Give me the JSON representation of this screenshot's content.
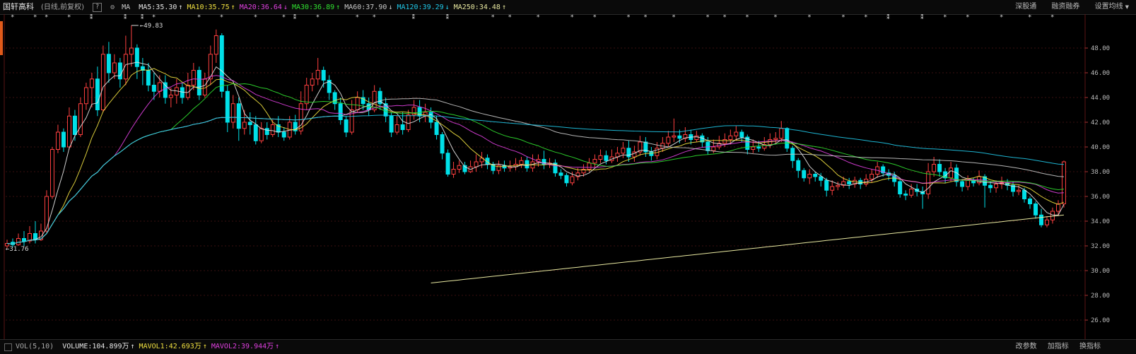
{
  "header": {
    "stock_name": "国轩高科",
    "period_label": "(日线,前复权)",
    "help_label": "?",
    "ma_label": "MA",
    "ma_items": [
      {
        "text": "MA5:35.30",
        "arrow": "↑",
        "color": "#e6e6e6"
      },
      {
        "text": "MA10:35.75",
        "arrow": "↑",
        "color": "#f0e040"
      },
      {
        "text": "MA20:36.64",
        "arrow": "↓",
        "color": "#e040e0"
      },
      {
        "text": "MA30:36.89",
        "arrow": "↑",
        "color": "#30e030"
      },
      {
        "text": "MA60:37.90",
        "arrow": "↓",
        "color": "#c8c8c8"
      },
      {
        "text": "MA120:39.29",
        "arrow": "↓",
        "color": "#20c8e8"
      },
      {
        "text": "MA250:34.48",
        "arrow": "↑",
        "color": "#e8e8a0"
      }
    ],
    "tools": [
      "深股通",
      "融资融券",
      "设置均线"
    ]
  },
  "footer": {
    "vol_name": "VOL(5,10)",
    "vol_items": [
      {
        "text": "VOLUME:104.899万",
        "arrow": "↑",
        "color": "#e6e6e6"
      },
      {
        "text": "MAVOL1:42.693万",
        "arrow": "↑",
        "color": "#f0e040"
      },
      {
        "text": "MAVOL2:39.944万",
        "arrow": "↑",
        "color": "#e040e0"
      }
    ],
    "tools": [
      "改参数",
      "加指标",
      "换指标"
    ]
  },
  "annotations": {
    "high": "49.83",
    "low": "31.76"
  },
  "colors": {
    "up": "#ff4040",
    "down": "#00e0e8",
    "grid": "#3a1010"
  },
  "chart_data": {
    "type": "candlestick",
    "ylim": [
      25,
      50
    ],
    "yticks": [
      "48.00",
      "46.00",
      "44.00",
      "42.00",
      "40.00",
      "38.00",
      "36.00",
      "34.00",
      "32.00",
      "30.00",
      "28.00",
      "26.00"
    ],
    "candles": [
      [
        32.0,
        32.2,
        31.8,
        32.5
      ],
      [
        32.3,
        32.1,
        31.9,
        32.6
      ],
      [
        32.1,
        32.6,
        32.0,
        33.0
      ],
      [
        32.6,
        32.4,
        32.0,
        33.2
      ],
      [
        32.4,
        33.0,
        32.2,
        33.6
      ],
      [
        33.0,
        32.5,
        32.2,
        34.0
      ],
      [
        32.5,
        33.2,
        32.4,
        33.8
      ],
      [
        33.2,
        36.0,
        33.0,
        36.5
      ],
      [
        36.0,
        39.8,
        35.8,
        40.0
      ],
      [
        39.8,
        41.2,
        39.5,
        41.8
      ],
      [
        41.2,
        40.0,
        39.6,
        41.5
      ],
      [
        40.0,
        42.5,
        39.8,
        43.2
      ],
      [
        42.5,
        41.0,
        40.5,
        43.0
      ],
      [
        41.0,
        43.5,
        40.8,
        44.0
      ],
      [
        43.5,
        44.8,
        43.0,
        45.2
      ],
      [
        44.8,
        45.5,
        43.2,
        46.0
      ],
      [
        45.5,
        43.0,
        42.5,
        46.5
      ],
      [
        43.0,
        47.5,
        42.8,
        48.2
      ],
      [
        47.5,
        46.0,
        45.2,
        48.5
      ],
      [
        46.0,
        46.8,
        45.5,
        47.5
      ],
      [
        46.8,
        45.5,
        44.8,
        47.2
      ],
      [
        45.5,
        47.5,
        45.0,
        49.0
      ],
      [
        47.5,
        48.0,
        46.5,
        49.83
      ],
      [
        48.0,
        46.5,
        45.5,
        48.3
      ],
      [
        46.5,
        46.2,
        45.0,
        47.2
      ],
      [
        46.2,
        45.0,
        44.5,
        46.8
      ],
      [
        45.0,
        44.5,
        43.8,
        46.0
      ],
      [
        44.5,
        45.2,
        44.0,
        45.8
      ],
      [
        45.2,
        44.0,
        43.5,
        45.8
      ],
      [
        44.0,
        44.2,
        43.2,
        44.8
      ],
      [
        44.2,
        44.8,
        43.5,
        45.5
      ],
      [
        44.8,
        44.0,
        43.5,
        45.2
      ],
      [
        44.0,
        45.0,
        43.8,
        46.0
      ],
      [
        45.0,
        46.2,
        44.6,
        46.8
      ],
      [
        46.2,
        44.2,
        43.8,
        46.5
      ],
      [
        44.2,
        45.5,
        44.0,
        46.0
      ],
      [
        45.5,
        47.5,
        45.0,
        48.2
      ],
      [
        47.5,
        49.0,
        46.8,
        49.5
      ],
      [
        49.0,
        44.5,
        44.0,
        49.2
      ],
      [
        44.5,
        42.0,
        41.2,
        45.0
      ],
      [
        42.0,
        43.5,
        41.5,
        44.2
      ],
      [
        43.5,
        41.5,
        40.5,
        44.0
      ],
      [
        41.5,
        42.0,
        41.0,
        43.0
      ],
      [
        42.0,
        41.8,
        41.0,
        42.8
      ],
      [
        41.8,
        40.5,
        40.2,
        42.5
      ],
      [
        40.5,
        41.5,
        40.3,
        42.0
      ],
      [
        41.5,
        41.0,
        40.6,
        42.0
      ],
      [
        41.0,
        41.8,
        40.8,
        42.2
      ],
      [
        41.8,
        41.2,
        40.8,
        42.5
      ],
      [
        41.2,
        40.8,
        40.5,
        41.6
      ],
      [
        40.8,
        42.0,
        40.6,
        42.5
      ],
      [
        42.0,
        41.3,
        41.0,
        42.6
      ],
      [
        41.3,
        43.5,
        41.0,
        44.5
      ],
      [
        43.5,
        45.0,
        43.0,
        45.6
      ],
      [
        45.0,
        45.5,
        44.5,
        46.0
      ],
      [
        45.5,
        46.2,
        45.0,
        47.2
      ],
      [
        46.2,
        45.4,
        44.8,
        46.5
      ],
      [
        45.4,
        44.4,
        43.8,
        45.8
      ],
      [
        44.4,
        43.5,
        43.0,
        44.6
      ],
      [
        43.5,
        42.2,
        41.8,
        44.0
      ],
      [
        42.2,
        41.2,
        40.8,
        42.5
      ],
      [
        41.2,
        43.0,
        41.0,
        43.8
      ],
      [
        43.0,
        44.0,
        42.8,
        44.5
      ],
      [
        44.0,
        43.5,
        43.0,
        44.6
      ],
      [
        43.5,
        43.0,
        42.5,
        44.0
      ],
      [
        43.0,
        44.5,
        42.8,
        45.0
      ],
      [
        44.5,
        43.5,
        43.0,
        44.8
      ],
      [
        43.5,
        42.5,
        42.0,
        44.0
      ],
      [
        42.5,
        41.2,
        40.8,
        42.8
      ],
      [
        41.2,
        41.8,
        41.0,
        42.5
      ],
      [
        41.8,
        41.4,
        41.0,
        42.8
      ],
      [
        41.4,
        42.6,
        41.2,
        43.0
      ],
      [
        42.6,
        43.2,
        42.2,
        43.8
      ],
      [
        43.2,
        42.5,
        42.0,
        43.8
      ],
      [
        42.5,
        42.8,
        42.0,
        43.5
      ],
      [
        42.8,
        42.0,
        41.5,
        43.2
      ],
      [
        42.0,
        41.0,
        40.6,
        42.5
      ],
      [
        41.0,
        39.5,
        39.0,
        41.2
      ],
      [
        39.5,
        37.8,
        37.6,
        39.8
      ],
      [
        37.8,
        38.2,
        37.5,
        38.8
      ],
      [
        38.2,
        38.5,
        37.9,
        38.9
      ],
      [
        38.5,
        38.0,
        37.8,
        38.8
      ],
      [
        38.0,
        38.4,
        37.9,
        38.9
      ],
      [
        38.4,
        38.8,
        38.0,
        39.4
      ],
      [
        38.8,
        39.1,
        38.3,
        39.6
      ],
      [
        39.1,
        38.6,
        38.2,
        39.4
      ],
      [
        38.6,
        38.1,
        37.8,
        38.8
      ],
      [
        38.1,
        38.5,
        37.8,
        38.9
      ],
      [
        38.5,
        38.3,
        38.0,
        38.9
      ],
      [
        38.3,
        38.4,
        38.0,
        38.9
      ],
      [
        38.4,
        38.6,
        38.1,
        39.1
      ],
      [
        38.6,
        38.9,
        38.3,
        39.2
      ],
      [
        38.9,
        38.3,
        38.0,
        39.2
      ],
      [
        38.3,
        38.8,
        38.0,
        39.4
      ],
      [
        38.8,
        39.0,
        38.4,
        39.4
      ],
      [
        39.0,
        38.6,
        38.2,
        39.7
      ],
      [
        38.6,
        38.7,
        38.3,
        39.1
      ],
      [
        38.7,
        37.9,
        37.6,
        39.0
      ],
      [
        37.9,
        37.7,
        37.4,
        38.2
      ],
      [
        37.7,
        37.1,
        36.8,
        37.9
      ],
      [
        37.1,
        37.6,
        36.9,
        38.0
      ],
      [
        37.6,
        37.9,
        37.3,
        38.3
      ],
      [
        37.9,
        38.2,
        37.6,
        38.6
      ],
      [
        38.2,
        38.7,
        38.0,
        39.1
      ],
      [
        38.7,
        39.0,
        38.3,
        39.4
      ],
      [
        39.0,
        39.3,
        38.7,
        39.8
      ],
      [
        39.3,
        38.9,
        38.6,
        39.7
      ],
      [
        38.9,
        39.2,
        38.7,
        39.8
      ],
      [
        39.2,
        39.5,
        38.8,
        40.0
      ],
      [
        39.5,
        39.9,
        39.1,
        40.4
      ],
      [
        39.9,
        39.2,
        38.8,
        40.5
      ],
      [
        39.2,
        39.6,
        38.8,
        40.1
      ],
      [
        39.6,
        40.4,
        39.3,
        40.9
      ],
      [
        40.4,
        39.6,
        39.2,
        40.8
      ],
      [
        39.6,
        39.3,
        38.9,
        40.0
      ],
      [
        39.3,
        39.9,
        39.0,
        40.4
      ],
      [
        39.9,
        40.3,
        39.6,
        40.8
      ],
      [
        40.3,
        40.8,
        40.0,
        41.3
      ],
      [
        40.8,
        40.9,
        40.4,
        42.3
      ],
      [
        40.9,
        40.7,
        40.3,
        41.4
      ],
      [
        40.7,
        41.0,
        40.4,
        41.6
      ],
      [
        41.0,
        40.6,
        40.2,
        41.4
      ],
      [
        40.6,
        40.9,
        40.4,
        41.3
      ],
      [
        40.9,
        40.4,
        40.0,
        41.1
      ],
      [
        40.4,
        39.7,
        39.4,
        40.8
      ],
      [
        39.7,
        40.0,
        39.5,
        40.6
      ],
      [
        40.0,
        40.3,
        39.8,
        40.9
      ],
      [
        40.3,
        40.6,
        40.0,
        41.1
      ],
      [
        40.6,
        40.9,
        40.2,
        41.4
      ],
      [
        40.9,
        41.2,
        40.5,
        41.7
      ],
      [
        41.2,
        40.8,
        40.4,
        41.4
      ],
      [
        40.8,
        39.8,
        39.4,
        41.0
      ],
      [
        39.8,
        40.0,
        39.5,
        40.6
      ],
      [
        40.0,
        39.9,
        39.6,
        40.5
      ],
      [
        39.9,
        40.2,
        39.7,
        40.8
      ],
      [
        40.2,
        40.6,
        39.9,
        41.1
      ],
      [
        40.6,
        40.7,
        40.3,
        41.2
      ],
      [
        40.7,
        41.5,
        40.4,
        42.1
      ],
      [
        41.5,
        39.9,
        39.6,
        41.6
      ],
      [
        39.9,
        38.9,
        38.3,
        40.1
      ],
      [
        38.9,
        38.1,
        37.5,
        39.1
      ],
      [
        38.1,
        37.5,
        37.2,
        38.3
      ],
      [
        37.5,
        37.8,
        37.0,
        38.2
      ],
      [
        37.8,
        37.6,
        37.2,
        38.0
      ],
      [
        37.6,
        37.3,
        36.8,
        37.9
      ],
      [
        37.3,
        36.5,
        36.0,
        37.5
      ],
      [
        36.5,
        36.8,
        36.1,
        37.3
      ],
      [
        36.8,
        36.9,
        36.5,
        37.2
      ],
      [
        36.9,
        37.2,
        36.7,
        37.6
      ],
      [
        37.2,
        37.0,
        36.6,
        37.5
      ],
      [
        37.0,
        37.3,
        36.7,
        37.6
      ],
      [
        37.3,
        37.0,
        36.6,
        37.5
      ],
      [
        37.0,
        37.4,
        36.8,
        37.8
      ],
      [
        37.4,
        37.8,
        37.1,
        38.2
      ],
      [
        37.8,
        38.4,
        37.5,
        38.8
      ],
      [
        38.4,
        37.9,
        37.6,
        38.6
      ],
      [
        37.9,
        37.7,
        37.3,
        38.2
      ],
      [
        37.7,
        37.2,
        36.8,
        38.0
      ],
      [
        37.2,
        36.2,
        35.9,
        37.4
      ],
      [
        36.2,
        36.1,
        35.7,
        36.5
      ],
      [
        36.1,
        36.6,
        35.9,
        37.0
      ],
      [
        36.6,
        36.4,
        36.0,
        37.0
      ],
      [
        36.4,
        36.2,
        35.0,
        36.8
      ],
      [
        36.2,
        38.0,
        35.8,
        38.7
      ],
      [
        38.0,
        38.6,
        37.6,
        39.2
      ],
      [
        38.6,
        38.0,
        37.6,
        39.0
      ],
      [
        38.0,
        37.5,
        37.1,
        38.3
      ],
      [
        37.5,
        38.3,
        37.2,
        38.8
      ],
      [
        38.3,
        37.2,
        36.8,
        38.6
      ],
      [
        37.2,
        36.8,
        36.4,
        37.4
      ],
      [
        36.8,
        37.3,
        36.5,
        37.7
      ],
      [
        37.3,
        37.1,
        36.8,
        37.5
      ],
      [
        37.1,
        37.6,
        36.9,
        38.1
      ],
      [
        37.6,
        36.9,
        35.1,
        37.8
      ],
      [
        36.9,
        36.7,
        36.3,
        37.2
      ],
      [
        36.7,
        37.0,
        36.3,
        37.3
      ],
      [
        37.0,
        37.1,
        36.6,
        37.6
      ],
      [
        37.1,
        36.9,
        36.5,
        37.4
      ],
      [
        36.9,
        36.4,
        36.0,
        37.2
      ],
      [
        36.4,
        36.5,
        36.1,
        36.9
      ],
      [
        36.5,
        35.8,
        35.5,
        36.7
      ],
      [
        35.8,
        35.4,
        35.0,
        36.0
      ],
      [
        35.4,
        34.5,
        34.2,
        35.6
      ],
      [
        34.5,
        33.7,
        33.5,
        35.0
      ],
      [
        33.7,
        34.1,
        33.5,
        34.4
      ],
      [
        34.1,
        34.8,
        33.8,
        35.1
      ],
      [
        34.8,
        35.4,
        34.4,
        35.7
      ],
      [
        35.4,
        38.8,
        35.1,
        38.9
      ]
    ]
  }
}
